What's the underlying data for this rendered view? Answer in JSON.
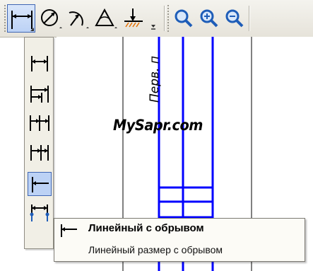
{
  "toolbar": {
    "buttons": [
      {
        "name": "linear-dimension-icon",
        "active": true
      },
      {
        "name": "diametral-dimension-icon"
      },
      {
        "name": "radial-dimension-icon"
      },
      {
        "name": "angular-dimension-icon"
      },
      {
        "name": "height-dimension-icon"
      }
    ],
    "zoom": [
      {
        "name": "zoom-window-icon"
      },
      {
        "name": "zoom-in-icon"
      },
      {
        "name": "zoom-out-icon"
      }
    ]
  },
  "flyout": {
    "items": [
      {
        "name": "linear-dimension-icon"
      },
      {
        "name": "linear-from-base-icon"
      },
      {
        "name": "linear-chain-icon"
      },
      {
        "name": "linear-common-base-icon"
      },
      {
        "name": "linear-with-break-icon",
        "selected": true
      },
      {
        "name": "linear-with-shelf-icon"
      }
    ]
  },
  "drawing": {
    "watermark": "MySapr.com",
    "vertical_text": "Перв. п",
    "line_color": "#0000ff"
  },
  "tooltip": {
    "title": "Линейный с обрывом",
    "description": "Линейный размер с обрывом"
  }
}
